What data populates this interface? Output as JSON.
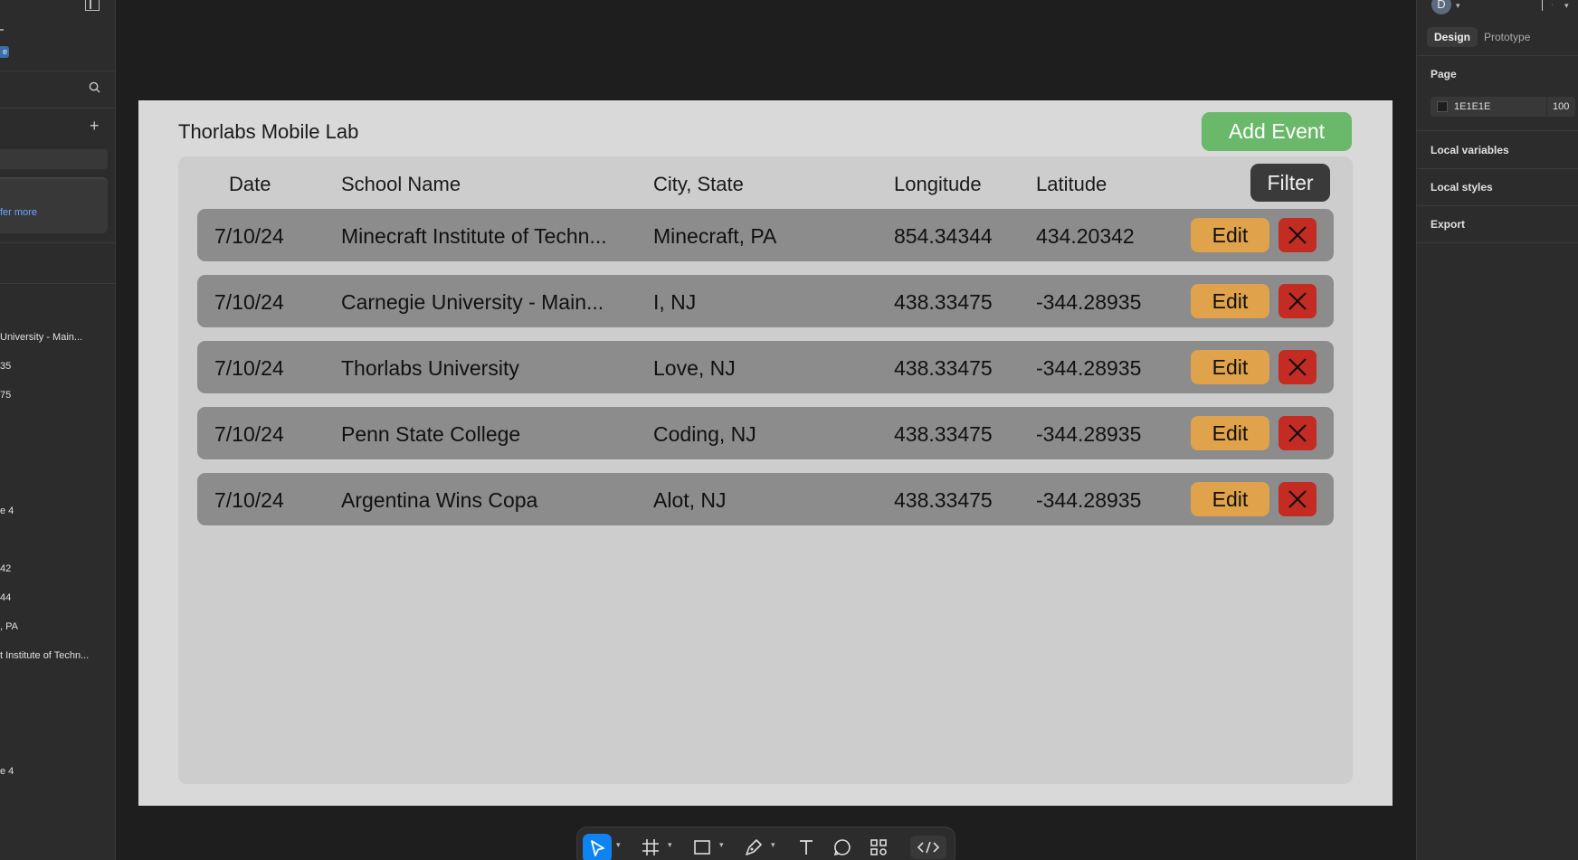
{
  "left_panel": {
    "badge_text": "e",
    "card_link": "fer more",
    "layers": [
      {
        "label": "University - Main..."
      },
      {
        "label": "35"
      },
      {
        "label": "75"
      },
      {
        "label": "e 4"
      },
      {
        "label": "42"
      },
      {
        "label": "44"
      },
      {
        "label": ", PA"
      },
      {
        "label": "t Institute of Techn..."
      },
      {
        "label": "e 4"
      }
    ]
  },
  "app": {
    "title": "Thorlabs Mobile Lab",
    "add_event_label": "Add Event",
    "filter_label": "Filter",
    "edit_label": "Edit",
    "columns": [
      "Date",
      "School Name",
      "City, State",
      "Longitude",
      "Latitude"
    ],
    "rows": [
      {
        "date": "7/10/24",
        "school": "Minecraft Institute of Techn...",
        "city": "Minecraft, PA",
        "longitude": "854.34344",
        "latitude": "434.20342"
      },
      {
        "date": "7/10/24",
        "school": "Carnegie University - Main...",
        "city": "I, NJ",
        "longitude": "438.33475",
        "latitude": "-344.28935"
      },
      {
        "date": "7/10/24",
        "school": "Thorlabs University",
        "city": "Love, NJ",
        "longitude": "438.33475",
        "latitude": "-344.28935"
      },
      {
        "date": "7/10/24",
        "school": "Penn State College",
        "city": "Coding, NJ",
        "longitude": "438.33475",
        "latitude": "-344.28935"
      },
      {
        "date": "7/10/24",
        "school": "Argentina Wins Copa",
        "city": "Alot, NJ",
        "longitude": "438.33475",
        "latitude": "-344.28935"
      }
    ]
  },
  "right_panel": {
    "avatar_initial": "D",
    "tabs": {
      "design": "Design",
      "prototype": "Prototype"
    },
    "page_label": "Page",
    "page_color_hex": "1E1E1E",
    "page_opacity": "100",
    "local_variables": "Local variables",
    "local_styles": "Local styles",
    "export": "Export"
  },
  "colors": {
    "canvas_bg": "#1e1e1e",
    "frame_bg": "#d9d9d9",
    "add_event_green": "#6ab86a",
    "edit_orange": "#e0a24a",
    "delete_red": "#c42b23",
    "accent_blue": "#0d84f2"
  },
  "toolbar": {
    "icons": [
      "move-icon",
      "frame-icon",
      "rectangle-icon",
      "pen-icon",
      "text-icon",
      "comment-icon",
      "components-icon",
      "code-icon"
    ]
  }
}
